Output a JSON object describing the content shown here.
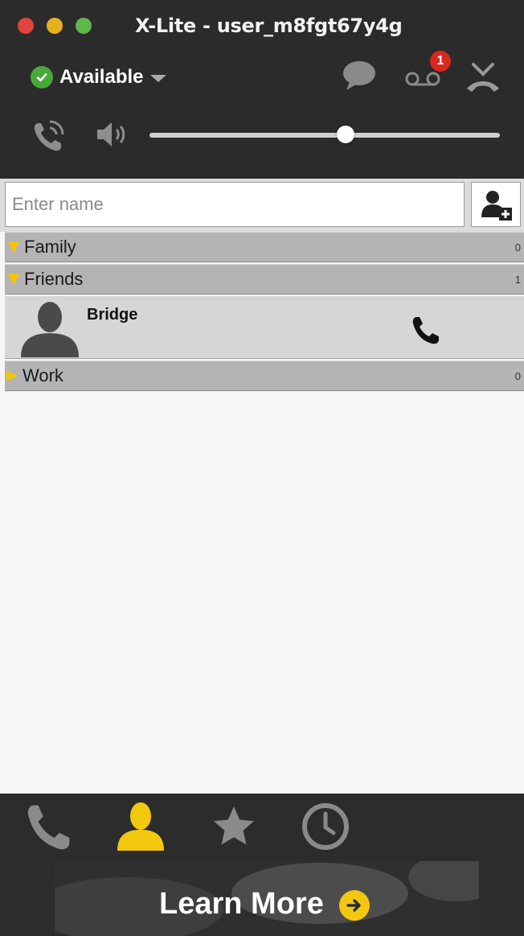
{
  "window": {
    "title": "X-Lite - user_m8fgt67y4g"
  },
  "toolbar": {
    "status_label": "Available",
    "voicemail_count": "1",
    "volume_level": 0.56
  },
  "search": {
    "placeholder": "Enter name",
    "value": ""
  },
  "groups": [
    {
      "label": "Family",
      "count": "0",
      "expanded": true
    },
    {
      "label": "Friends",
      "count": "1",
      "expanded": true
    },
    {
      "label": "Work",
      "count": "0",
      "expanded": false
    }
  ],
  "contacts": [
    {
      "name": "Bridge",
      "group": "Friends"
    }
  ],
  "tabs": [
    {
      "icon": "phone-icon",
      "active": false
    },
    {
      "icon": "contacts-icon",
      "active": true
    },
    {
      "icon": "star-icon",
      "active": false
    },
    {
      "icon": "clock-icon",
      "active": false
    }
  ],
  "banner": {
    "label": "Learn More"
  },
  "colors": {
    "accent": "#f5c400",
    "header_bg": "#2b2b2b",
    "status_green": "#49a83a",
    "badge_red": "#d8281f"
  }
}
